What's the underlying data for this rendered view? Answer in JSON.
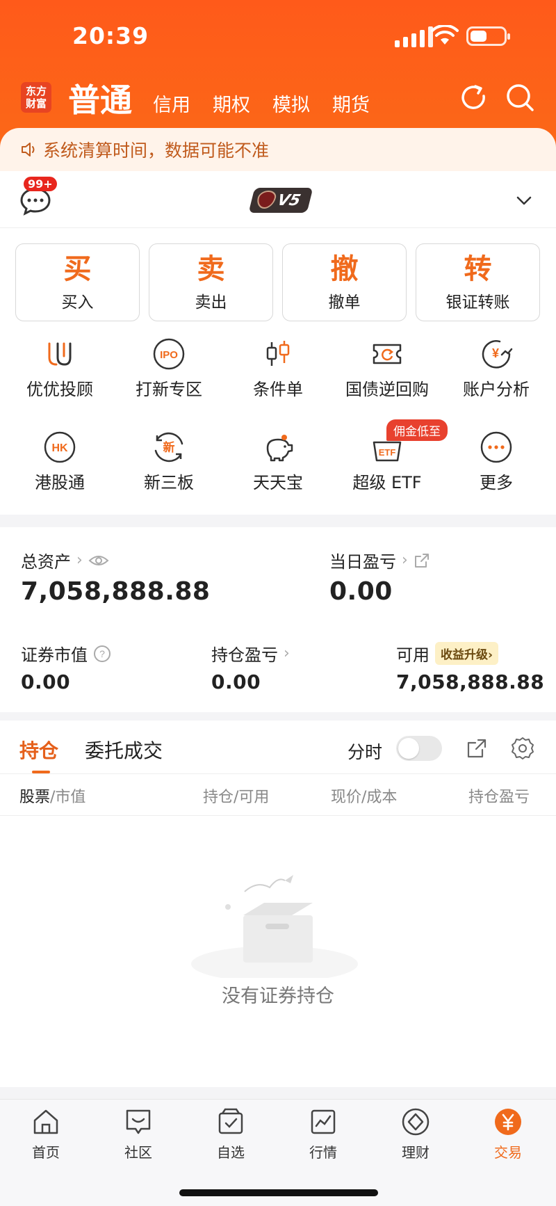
{
  "status": {
    "time": "20:39"
  },
  "header": {
    "logo_text_line1": "东方",
    "logo_text_line2": "财富",
    "tabs": [
      {
        "label": "普通",
        "active": true
      },
      {
        "label": "信用"
      },
      {
        "label": "期权"
      },
      {
        "label": "模拟"
      },
      {
        "label": "期货"
      }
    ],
    "icons": [
      "refresh-icon",
      "search-icon"
    ]
  },
  "notice": {
    "text": "系统清算时间，数据可能不准"
  },
  "account": {
    "message_badge": "99+",
    "level": "V5"
  },
  "actions": [
    {
      "char": "买",
      "label": "买入"
    },
    {
      "char": "卖",
      "label": "卖出"
    },
    {
      "char": "撤",
      "label": "撤单"
    },
    {
      "char": "转",
      "label": "银证转账"
    }
  ],
  "shortcuts": [
    {
      "label": "优优投顾",
      "icon": "uu-advisor-icon"
    },
    {
      "label": "打新专区",
      "icon": "ipo-icon",
      "icon_text": "IPO"
    },
    {
      "label": "条件单",
      "icon": "candlestick-icon"
    },
    {
      "label": "国债逆回购",
      "icon": "ticket-refresh-icon"
    },
    {
      "label": "账户分析",
      "icon": "yuan-chart-icon",
      "icon_text": "¥"
    },
    {
      "label": "港股通",
      "icon": "hk-icon",
      "icon_text": "HK"
    },
    {
      "label": "新三板",
      "icon": "xin-icon",
      "icon_text": "新"
    },
    {
      "label": "天天宝",
      "icon": "piggy-bank-icon"
    },
    {
      "label": "超级 ETF",
      "icon": "etf-icon",
      "icon_text": "ETF",
      "tag": "佣金低至"
    },
    {
      "label": "更多",
      "icon": "more-icon"
    }
  ],
  "assets": {
    "total_label": "总资产",
    "total_value": "7,058,888.88",
    "daily_pl_label": "当日盈亏",
    "daily_pl_value": "0.00",
    "market_value_label": "证券市值",
    "market_value": "0.00",
    "position_pl_label": "持仓盈亏",
    "position_pl_value": "0.00",
    "available_label": "可用",
    "available_tag": "收益升级",
    "available_value": "7,058,888.88"
  },
  "positions": {
    "tabs": [
      {
        "label": "持仓",
        "active": true
      },
      {
        "label": "委托成交"
      }
    ],
    "timeshare_label": "分时",
    "columns": [
      {
        "main": "股票",
        "sub": "/市值"
      },
      {
        "main": "持仓",
        "sub": "/可用"
      },
      {
        "main": "现价",
        "sub": "/成本"
      },
      {
        "main": "持仓盈亏",
        "sub": ""
      }
    ],
    "empty_text": "没有证券持仓"
  },
  "tabbar": [
    {
      "label": "首页",
      "icon": "home-icon"
    },
    {
      "label": "社区",
      "icon": "community-icon"
    },
    {
      "label": "自选",
      "icon": "watchlist-icon"
    },
    {
      "label": "行情",
      "icon": "market-icon"
    },
    {
      "label": "理财",
      "icon": "wealth-icon"
    },
    {
      "label": "交易",
      "icon": "trade-icon",
      "active": true
    }
  ],
  "colors": {
    "brand": "#f06a1c",
    "header": "#ff5a1a",
    "notice_bg": "#fff3ea"
  }
}
